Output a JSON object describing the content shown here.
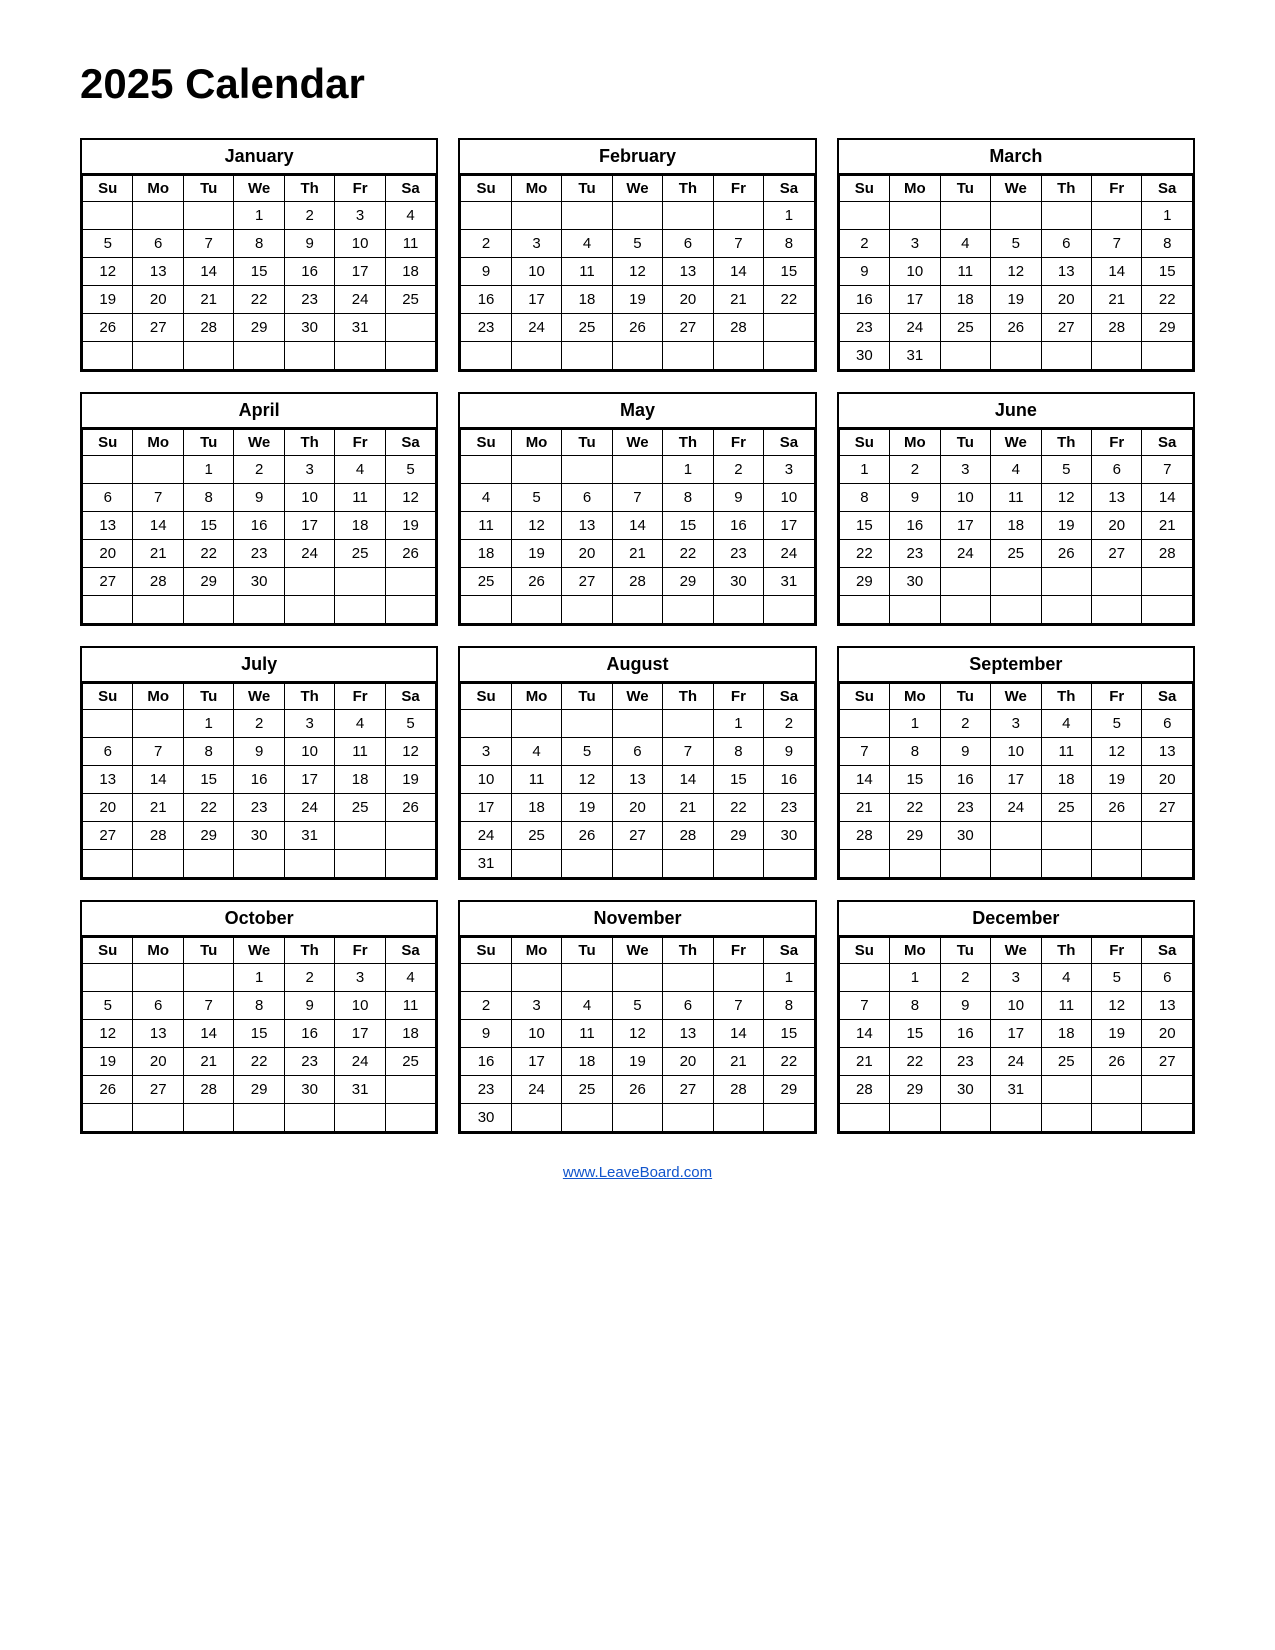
{
  "title": "2025 Calendar",
  "footer": "www.LeaveBoard.com",
  "days": [
    "Su",
    "Mo",
    "Tu",
    "We",
    "Th",
    "Fr",
    "Sa"
  ],
  "months": [
    {
      "name": "January",
      "weeks": [
        [
          "",
          "",
          "",
          "1",
          "2",
          "3",
          "4"
        ],
        [
          "5",
          "6",
          "7",
          "8",
          "9",
          "10",
          "11"
        ],
        [
          "12",
          "13",
          "14",
          "15",
          "16",
          "17",
          "18"
        ],
        [
          "19",
          "20",
          "21",
          "22",
          "23",
          "24",
          "25"
        ],
        [
          "26",
          "27",
          "28",
          "29",
          "30",
          "31",
          ""
        ],
        [
          "",
          "",
          "",
          "",
          "",
          "",
          ""
        ]
      ]
    },
    {
      "name": "February",
      "weeks": [
        [
          "",
          "",
          "",
          "",
          "",
          "",
          "1"
        ],
        [
          "2",
          "3",
          "4",
          "5",
          "6",
          "7",
          "8"
        ],
        [
          "9",
          "10",
          "11",
          "12",
          "13",
          "14",
          "15"
        ],
        [
          "16",
          "17",
          "18",
          "19",
          "20",
          "21",
          "22"
        ],
        [
          "23",
          "24",
          "25",
          "26",
          "27",
          "28",
          ""
        ],
        [
          "",
          "",
          "",
          "",
          "",
          "",
          ""
        ]
      ]
    },
    {
      "name": "March",
      "weeks": [
        [
          "",
          "",
          "",
          "",
          "",
          "",
          "1"
        ],
        [
          "2",
          "3",
          "4",
          "5",
          "6",
          "7",
          "8"
        ],
        [
          "9",
          "10",
          "11",
          "12",
          "13",
          "14",
          "15"
        ],
        [
          "16",
          "17",
          "18",
          "19",
          "20",
          "21",
          "22"
        ],
        [
          "23",
          "24",
          "25",
          "26",
          "27",
          "28",
          "29"
        ],
        [
          "30",
          "31",
          "",
          "",
          "",
          "",
          ""
        ]
      ]
    },
    {
      "name": "April",
      "weeks": [
        [
          "",
          "",
          "1",
          "2",
          "3",
          "4",
          "5"
        ],
        [
          "6",
          "7",
          "8",
          "9",
          "10",
          "11",
          "12"
        ],
        [
          "13",
          "14",
          "15",
          "16",
          "17",
          "18",
          "19"
        ],
        [
          "20",
          "21",
          "22",
          "23",
          "24",
          "25",
          "26"
        ],
        [
          "27",
          "28",
          "29",
          "30",
          "",
          "",
          ""
        ],
        [
          "",
          "",
          "",
          "",
          "",
          "",
          ""
        ]
      ]
    },
    {
      "name": "May",
      "weeks": [
        [
          "",
          "",
          "",
          "",
          "1",
          "2",
          "3"
        ],
        [
          "4",
          "5",
          "6",
          "7",
          "8",
          "9",
          "10"
        ],
        [
          "11",
          "12",
          "13",
          "14",
          "15",
          "16",
          "17"
        ],
        [
          "18",
          "19",
          "20",
          "21",
          "22",
          "23",
          "24"
        ],
        [
          "25",
          "26",
          "27",
          "28",
          "29",
          "30",
          "31"
        ],
        [
          "",
          "",
          "",
          "",
          "",
          "",
          ""
        ]
      ]
    },
    {
      "name": "June",
      "weeks": [
        [
          "1",
          "2",
          "3",
          "4",
          "5",
          "6",
          "7"
        ],
        [
          "8",
          "9",
          "10",
          "11",
          "12",
          "13",
          "14"
        ],
        [
          "15",
          "16",
          "17",
          "18",
          "19",
          "20",
          "21"
        ],
        [
          "22",
          "23",
          "24",
          "25",
          "26",
          "27",
          "28"
        ],
        [
          "29",
          "30",
          "",
          "",
          "",
          "",
          ""
        ],
        [
          "",
          "",
          "",
          "",
          "",
          "",
          ""
        ]
      ]
    },
    {
      "name": "July",
      "weeks": [
        [
          "",
          "",
          "1",
          "2",
          "3",
          "4",
          "5"
        ],
        [
          "6",
          "7",
          "8",
          "9",
          "10",
          "11",
          "12"
        ],
        [
          "13",
          "14",
          "15",
          "16",
          "17",
          "18",
          "19"
        ],
        [
          "20",
          "21",
          "22",
          "23",
          "24",
          "25",
          "26"
        ],
        [
          "27",
          "28",
          "29",
          "30",
          "31",
          "",
          ""
        ],
        [
          "",
          "",
          "",
          "",
          "",
          "",
          ""
        ]
      ]
    },
    {
      "name": "August",
      "weeks": [
        [
          "",
          "",
          "",
          "",
          "",
          "1",
          "2"
        ],
        [
          "3",
          "4",
          "5",
          "6",
          "7",
          "8",
          "9"
        ],
        [
          "10",
          "11",
          "12",
          "13",
          "14",
          "15",
          "16"
        ],
        [
          "17",
          "18",
          "19",
          "20",
          "21",
          "22",
          "23"
        ],
        [
          "24",
          "25",
          "26",
          "27",
          "28",
          "29",
          "30"
        ],
        [
          "31",
          "",
          "",
          "",
          "",
          "",
          ""
        ]
      ]
    },
    {
      "name": "September",
      "weeks": [
        [
          "",
          "1",
          "2",
          "3",
          "4",
          "5",
          "6"
        ],
        [
          "7",
          "8",
          "9",
          "10",
          "11",
          "12",
          "13"
        ],
        [
          "14",
          "15",
          "16",
          "17",
          "18",
          "19",
          "20"
        ],
        [
          "21",
          "22",
          "23",
          "24",
          "25",
          "26",
          "27"
        ],
        [
          "28",
          "29",
          "30",
          "",
          "",
          "",
          ""
        ],
        [
          "",
          "",
          "",
          "",
          "",
          "",
          ""
        ]
      ]
    },
    {
      "name": "October",
      "weeks": [
        [
          "",
          "",
          "",
          "1",
          "2",
          "3",
          "4"
        ],
        [
          "5",
          "6",
          "7",
          "8",
          "9",
          "10",
          "11"
        ],
        [
          "12",
          "13",
          "14",
          "15",
          "16",
          "17",
          "18"
        ],
        [
          "19",
          "20",
          "21",
          "22",
          "23",
          "24",
          "25"
        ],
        [
          "26",
          "27",
          "28",
          "29",
          "30",
          "31",
          ""
        ],
        [
          "",
          "",
          "",
          "",
          "",
          "",
          ""
        ]
      ]
    },
    {
      "name": "November",
      "weeks": [
        [
          "",
          "",
          "",
          "",
          "",
          "",
          "1"
        ],
        [
          "2",
          "3",
          "4",
          "5",
          "6",
          "7",
          "8"
        ],
        [
          "9",
          "10",
          "11",
          "12",
          "13",
          "14",
          "15"
        ],
        [
          "16",
          "17",
          "18",
          "19",
          "20",
          "21",
          "22"
        ],
        [
          "23",
          "24",
          "25",
          "26",
          "27",
          "28",
          "29"
        ],
        [
          "30",
          "",
          "",
          "",
          "",
          "",
          ""
        ]
      ]
    },
    {
      "name": "December",
      "weeks": [
        [
          "",
          "1",
          "2",
          "3",
          "4",
          "5",
          "6"
        ],
        [
          "7",
          "8",
          "9",
          "10",
          "11",
          "12",
          "13"
        ],
        [
          "14",
          "15",
          "16",
          "17",
          "18",
          "19",
          "20"
        ],
        [
          "21",
          "22",
          "23",
          "24",
          "25",
          "26",
          "27"
        ],
        [
          "28",
          "29",
          "30",
          "31",
          "",
          "",
          ""
        ],
        [
          "",
          "",
          "",
          "",
          "",
          "",
          ""
        ]
      ]
    }
  ]
}
